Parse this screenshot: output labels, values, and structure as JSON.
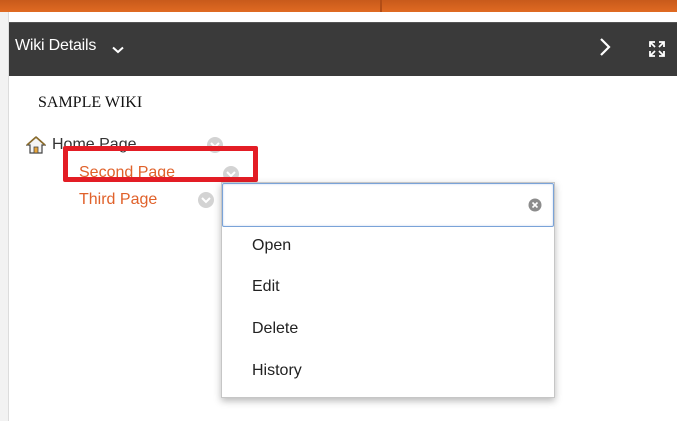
{
  "panel": {
    "title": "Wiki Details"
  },
  "wiki": {
    "name": "SAMPLE WIKI",
    "pages": [
      {
        "label": "Home Page"
      },
      {
        "label": "Second Page"
      },
      {
        "label": "Third Page"
      }
    ]
  },
  "menu": {
    "filter_value": "",
    "items": [
      {
        "label": "Open"
      },
      {
        "label": "Edit"
      },
      {
        "label": "Delete"
      },
      {
        "label": "History"
      }
    ]
  },
  "icons": {
    "header_caret": "chevron-down-icon",
    "collapse": "chevron-right-icon",
    "expand": "expand-icon",
    "home": "home-icon",
    "page_menu": "circle-chevron-down-icon",
    "clear": "clear-icon"
  },
  "colors": {
    "accent_orange": "#e06a22",
    "header_bg": "#3a3a3a",
    "link_orange": "#e0612a",
    "highlight_red": "#e31d25"
  }
}
